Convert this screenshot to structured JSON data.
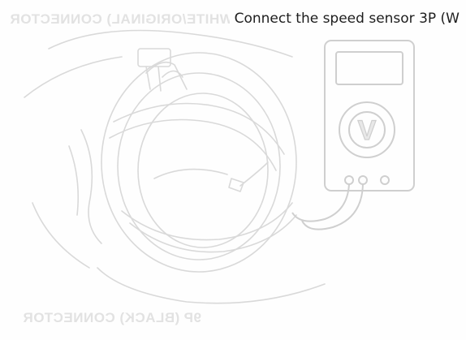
{
  "caption": "Connect the speed sensor 3P (W",
  "illustration": {
    "mirrored_labels": {
      "top": "(WHITE/ORIGINAL) CONNECTOR",
      "bottom": "9P (BLACK) CONNECTOR"
    },
    "meter_symbol": "V",
    "icon": "multimeter-icon"
  }
}
